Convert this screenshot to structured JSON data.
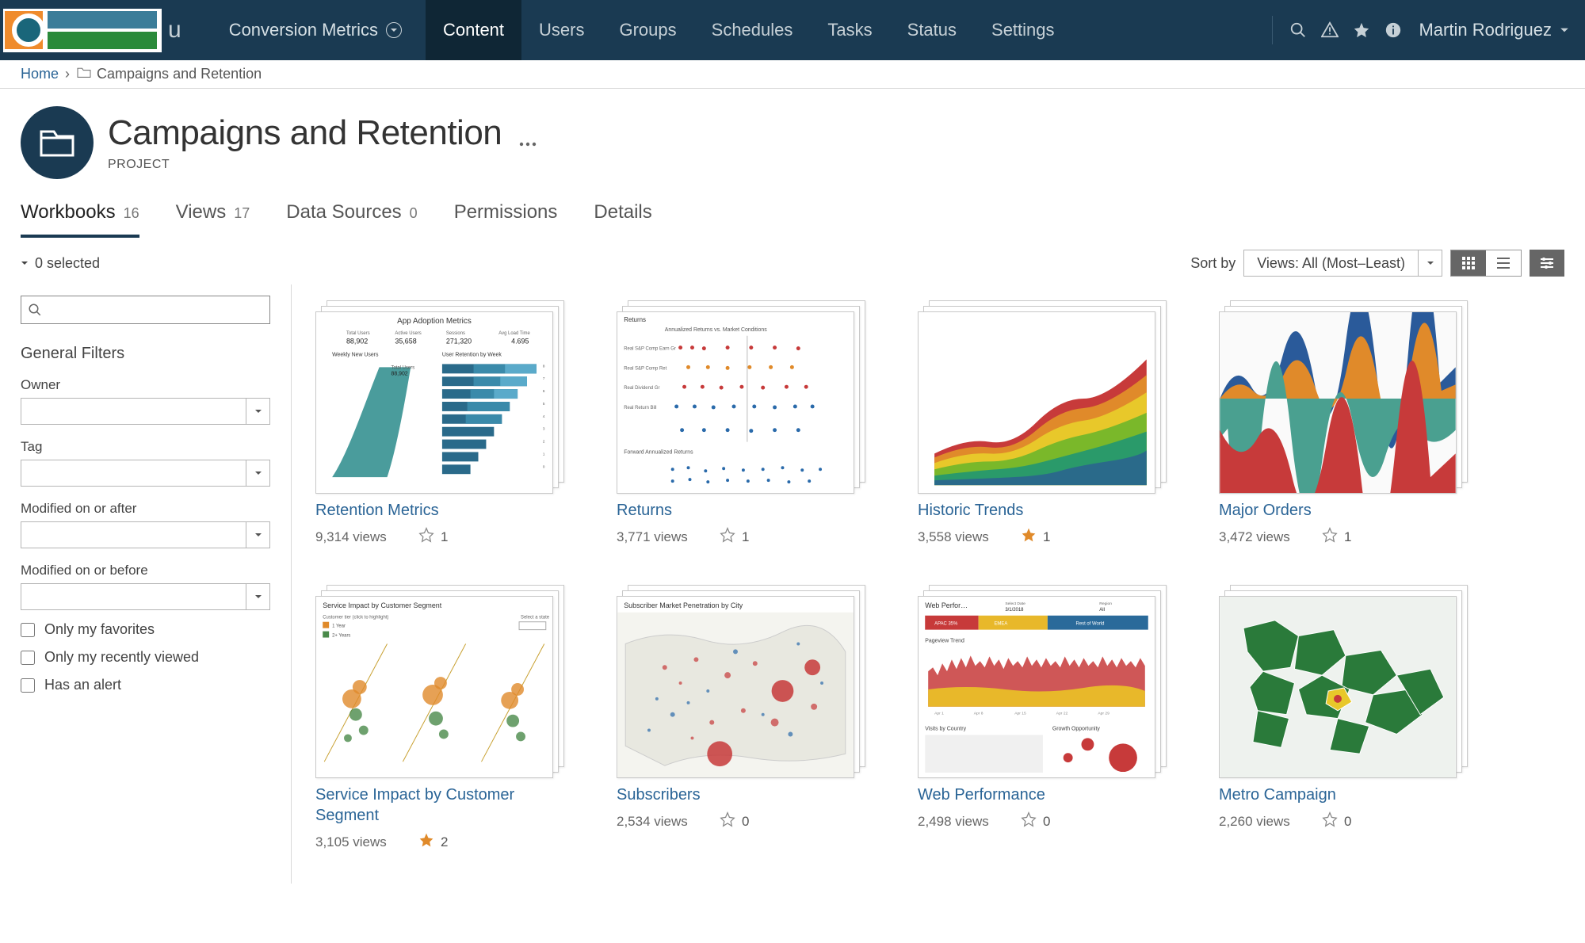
{
  "nav": {
    "site": "Conversion Metrics",
    "tabs": [
      "Content",
      "Users",
      "Groups",
      "Schedules",
      "Tasks",
      "Status",
      "Settings"
    ],
    "activeTab": "Content",
    "user": "Martin Rodriguez"
  },
  "breadcrumb": {
    "home": "Home",
    "current": "Campaigns and Retention"
  },
  "project": {
    "title": "Campaigns and Retention",
    "label": "PROJECT"
  },
  "contentTabs": [
    {
      "label": "Workbooks",
      "count": "16",
      "active": true
    },
    {
      "label": "Views",
      "count": "17"
    },
    {
      "label": "Data Sources",
      "count": "0"
    },
    {
      "label": "Permissions"
    },
    {
      "label": "Details"
    }
  ],
  "toolbar": {
    "selected": "0 selected",
    "sortByLabel": "Sort by",
    "sortValue": "Views: All (Most–Least)"
  },
  "filters": {
    "heading": "General Filters",
    "owner": "Owner",
    "tag": "Tag",
    "modafter": "Modified on or after",
    "modbefore": "Modified on or before",
    "onlyfav": "Only my favorites",
    "onlyrecent": "Only my recently viewed",
    "hasalert": "Has an alert"
  },
  "workbooks": [
    {
      "title": "Retention Metrics",
      "views": "9,314 views",
      "fav": "1",
      "starred": false
    },
    {
      "title": "Returns",
      "views": "3,771 views",
      "fav": "1",
      "starred": false
    },
    {
      "title": "Historic Trends",
      "views": "3,558 views",
      "fav": "1",
      "starred": true
    },
    {
      "title": "Major Orders",
      "views": "3,472 views",
      "fav": "1",
      "starred": false
    },
    {
      "title": "Service Impact by Customer Segment",
      "views": "3,105 views",
      "fav": "2",
      "starred": true
    },
    {
      "title": "Subscribers",
      "views": "2,534 views",
      "fav": "0",
      "starred": false
    },
    {
      "title": "Web Performance",
      "views": "2,498 views",
      "fav": "0",
      "starred": false
    },
    {
      "title": "Metro Campaign",
      "views": "2,260 views",
      "fav": "0",
      "starred": false
    }
  ]
}
